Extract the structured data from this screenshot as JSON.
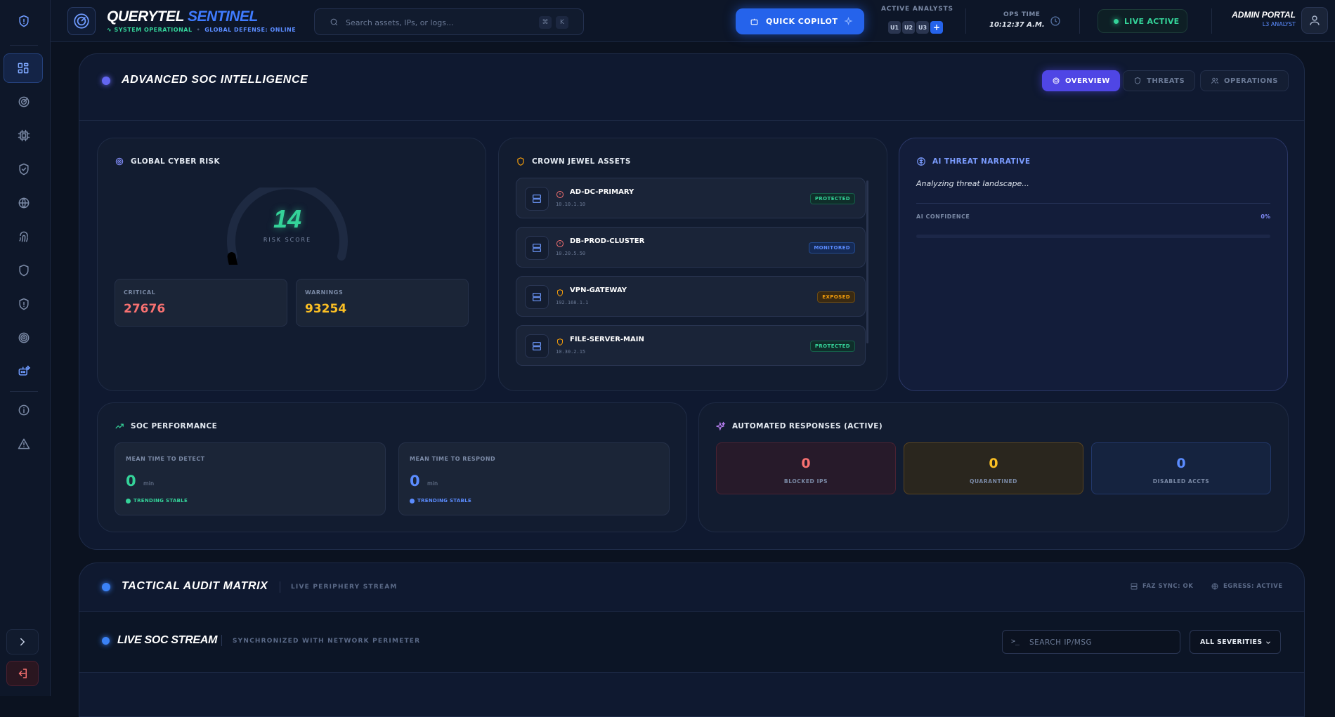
{
  "header": {
    "brand_1": "QUERYTEL",
    "brand_2": "SENTINEL",
    "status_1": "SYSTEM OPERATIONAL",
    "status_2": "GLOBAL DEFENSE: ONLINE",
    "search_placeholder": "Search assets, IPs, or logs...",
    "kbd_1": "⌘",
    "kbd_2": "K",
    "copilot_label": "QUICK COPILOT",
    "analysts_label": "ACTIVE ANALYSTS",
    "analysts": [
      "U1",
      "U2",
      "U3"
    ],
    "analysts_add": "+",
    "ops_label": "OPS TIME",
    "ops_time": "10:12:37 A.M.",
    "live_label": "LIVE ACTIVE",
    "admin_title": "ADMIN PORTAL",
    "admin_role": "L3 ANALYST"
  },
  "intel": {
    "title": "ADVANCED SOC INTELLIGENCE",
    "tabs": [
      {
        "label": "OVERVIEW",
        "icon": "target-icon",
        "active": true
      },
      {
        "label": "THREATS",
        "icon": "shield-icon",
        "active": false
      },
      {
        "label": "OPERATIONS",
        "icon": "users-icon",
        "active": false
      }
    ]
  },
  "risk": {
    "title": "GLOBAL CYBER RISK",
    "score": "14",
    "score_value": 14,
    "score_max": 100,
    "score_label": "RISK SCORE",
    "critical_label": "CRITICAL",
    "critical_value": "27676",
    "warnings_label": "WARNINGS",
    "warnings_value": "93254"
  },
  "assets": {
    "title": "CROWN JEWEL ASSETS",
    "items": [
      {
        "name": "AD-DC-PRIMARY",
        "ip": "10.10.1.10",
        "status": "PROTECTED",
        "status_icon": "alert-circle-icon"
      },
      {
        "name": "DB-PROD-CLUSTER",
        "ip": "10.20.5.50",
        "status": "MONITORED",
        "status_icon": "alert-circle-icon"
      },
      {
        "name": "VPN-GATEWAY",
        "ip": "192.168.1.1",
        "status": "EXPOSED",
        "status_icon": "shield-icon"
      },
      {
        "name": "FILE-SERVER-MAIN",
        "ip": "10.30.2.15",
        "status": "PROTECTED",
        "status_icon": "shield-icon"
      }
    ]
  },
  "ai": {
    "title": "AI THREAT NARRATIVE",
    "text": "Analyzing threat landscape...",
    "confidence_label": "AI CONFIDENCE",
    "confidence_value": "0%",
    "confidence_fraction": 0
  },
  "performance": {
    "title": "SOC PERFORMANCE",
    "mttd_label": "MEAN TIME TO DETECT",
    "mttd_value": "0",
    "mttd_unit": "min",
    "mttd_trend": "TRENDING STABLE",
    "mttr_label": "MEAN TIME TO RESPOND",
    "mttr_value": "0",
    "mttr_unit": "min",
    "mttr_trend": "TRENDING STABLE"
  },
  "responses": {
    "title": "AUTOMATED RESPONSES (ACTIVE)",
    "blocked_value": "0",
    "blocked_label": "BLOCKED IPS",
    "quarantined_value": "0",
    "quarantined_label": "QUARANTINED",
    "disabled_value": "0",
    "disabled_label": "DISABLED ACCTS"
  },
  "audit": {
    "title": "TACTICAL AUDIT MATRIX",
    "subtitle": "LIVE PERIPHERY STREAM",
    "faz": "FAZ SYNC: OK",
    "egress": "EGRESS: ACTIVE"
  },
  "stream": {
    "title": "LIVE SOC STREAM",
    "subtitle": "SYNCHRONIZED WITH NETWORK PERIMETER",
    "prompt": ">_",
    "search_placeholder": "SEARCH IP/MSG",
    "severity": "ALL SEVERITIES"
  },
  "colors": {
    "accent": "#2563eb",
    "success": "#34d399",
    "critical": "#f87171",
    "warning": "#fbbf24",
    "indigo": "#6366f1"
  }
}
